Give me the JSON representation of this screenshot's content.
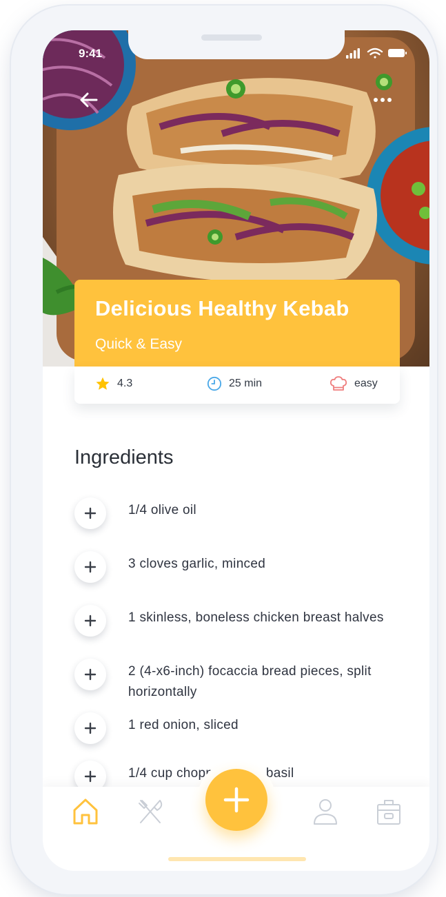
{
  "status_bar": {
    "time": "9:41"
  },
  "recipe": {
    "title": "Delicious Healthy Kebab",
    "subtitle": "Quick & Easy",
    "rating": "4.3",
    "duration": "25 min",
    "difficulty": "easy"
  },
  "ingredients": {
    "heading": "Ingredients",
    "items": [
      {
        "text": "1/4 olive oil"
      },
      {
        "text": "3 cloves garlic, minced"
      },
      {
        "text": "1 skinless, boneless chicken breast halves"
      },
      {
        "text": "2 (4-x6-inch) focaccia bread pieces, split horizontally"
      },
      {
        "text": "1 red onion, sliced"
      },
      {
        "text": "1/4 cup chopped fresh basil"
      }
    ]
  },
  "colors": {
    "accent": "#ffc23d",
    "text": "#2f3440",
    "star": "#ffc200",
    "clock": "#4aa8e8",
    "chef_hat": "#ef7f7f"
  },
  "icons": {
    "back": "arrow-left-icon",
    "more": "more-dots-icon",
    "rating": "star-icon",
    "duration": "clock-icon",
    "difficulty": "chef-hat-icon",
    "add_ingredient": "plus-icon",
    "tabs": [
      "home-icon",
      "fork-knife-icon",
      "plus-icon",
      "user-icon",
      "lunchbox-icon"
    ]
  }
}
